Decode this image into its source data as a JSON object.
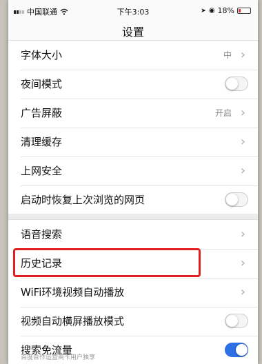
{
  "status": {
    "carrier": "中国联通",
    "time": "下午3:03",
    "battery": "18%"
  },
  "title": "设置",
  "groups": [
    {
      "rows": [
        {
          "label": "字体大小",
          "value": "中",
          "type": "chevron"
        },
        {
          "label": "夜间模式",
          "type": "toggle",
          "on": false
        },
        {
          "label": "广告屏蔽",
          "value": "开启",
          "type": "chevron"
        },
        {
          "label": "清理缓存",
          "type": "chevron"
        },
        {
          "label": "上网安全",
          "type": "chevron"
        },
        {
          "label": "启动时恢复上次浏览的网页",
          "type": "toggle",
          "on": false
        }
      ]
    },
    {
      "rows": [
        {
          "label": "语音搜索",
          "type": "chevron"
        },
        {
          "label": "历史记录",
          "type": "chevron"
        },
        {
          "label": "WiFi环境视频自动播放",
          "type": "chevron"
        },
        {
          "label": "视频自动横屏播放模式",
          "type": "toggle",
          "on": false
        },
        {
          "label": "搜索免流量",
          "type": "toggle",
          "on": true
        }
      ]
    }
  ],
  "footer_note": "百度合作运营商卡用户独享",
  "accent_color": "#2f6fe6",
  "highlight_color": "#e02020"
}
